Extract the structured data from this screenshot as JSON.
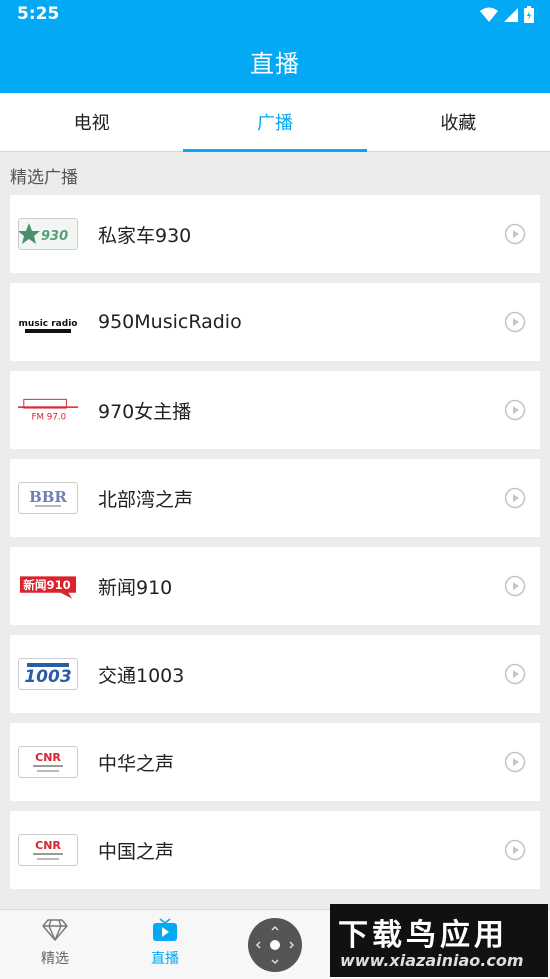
{
  "status": {
    "time": "5:25"
  },
  "appbar": {
    "title": "直播"
  },
  "tabs": [
    {
      "label": "电视"
    },
    {
      "label": "广播"
    },
    {
      "label": "收藏"
    }
  ],
  "section_title": "精选广播",
  "stations": [
    {
      "name": "私家车930",
      "logo_text": "930"
    },
    {
      "name": "950MusicRadio",
      "logo_text": "music radio"
    },
    {
      "name": "970女主播",
      "logo_text": "FM 97.0"
    },
    {
      "name": "北部湾之声",
      "logo_text": "BBR"
    },
    {
      "name": "新闻910",
      "logo_text": "新闻910"
    },
    {
      "name": "交通1003",
      "logo_text": "1003"
    },
    {
      "name": "中华之声",
      "logo_text": "CNR"
    },
    {
      "name": "中国之声",
      "logo_text": "CNR"
    }
  ],
  "bottom_nav": [
    {
      "label": "精选",
      "icon": "diamond-icon"
    },
    {
      "label": "直播",
      "icon": "tv-play-icon"
    }
  ],
  "watermark": {
    "title": "下载鸟应用",
    "url": "www.xiazainiao.com"
  },
  "colors": {
    "primary": "#03a9f4",
    "background": "#ececec"
  }
}
